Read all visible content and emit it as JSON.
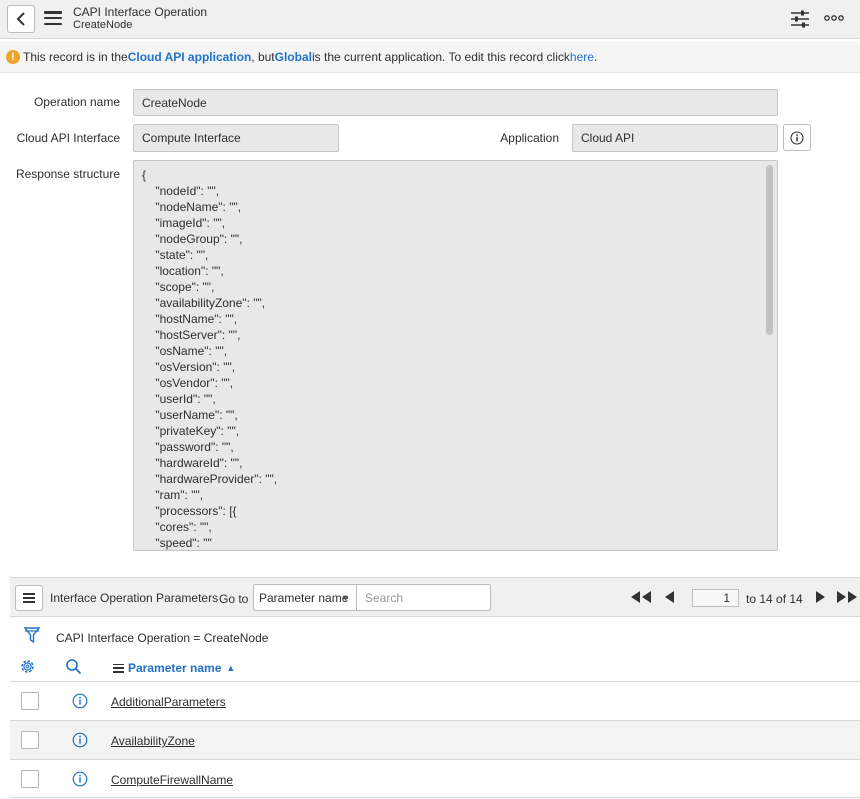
{
  "header": {
    "title": "CAPI Interface Operation",
    "subtitle": "CreateNode"
  },
  "notice": {
    "part1": "This record is in the ",
    "app_link": "Cloud API application",
    "part2": ", but ",
    "current_app": "Global",
    "part3": " is the current application. To edit this record click ",
    "here_link": "here",
    "part4": "."
  },
  "form": {
    "operation_name_label": "Operation name",
    "operation_name_value": "CreateNode",
    "cloud_api_interface_label": "Cloud API Interface",
    "cloud_api_interface_value": "Compute Interface",
    "application_label": "Application",
    "application_value": "Cloud API",
    "response_structure_label": "Response structure",
    "response_structure_value": "{\n    \"nodeId\": \"\",\n    \"nodeName\": \"\",\n    \"imageId\": \"\",\n    \"nodeGroup\": \"\",\n    \"state\": \"\",\n    \"location\": \"\",\n    \"scope\": \"\",\n    \"availabilityZone\": \"\",\n    \"hostName\": \"\",\n    \"hostServer\": \"\",\n    \"osName\": \"\",\n    \"osVersion\": \"\",\n    \"osVendor\": \"\",\n    \"userId\": \"\",\n    \"userName\": \"\",\n    \"privateKey\": \"\",\n    \"password\": \"\",\n    \"hardwareId\": \"\",\n    \"hardwareProvider\": \"\",\n    \"ram\": \"\",\n    \"processors\": [{\n    \"cores\": \"\",\n    \"speed\": \"\""
  },
  "list": {
    "title": "Interface Operation Parameters",
    "goto_label": "Go to",
    "goto_selected": "Parameter name",
    "search_placeholder": "Search",
    "page_value": "1",
    "page_of": "to 14 of 14",
    "filter_text": "CAPI Interface Operation = CreateNode",
    "column_header": "Parameter name",
    "rows": [
      {
        "name": "AdditionalParameters"
      },
      {
        "name": "AvailabilityZone"
      },
      {
        "name": "ComputeFirewallName"
      }
    ]
  },
  "colors": {
    "link": "#1f72c8",
    "warning": "#f0a32a",
    "header_bg": "#f0f0f0",
    "field_bg": "#e8e8e8"
  },
  "icons": {
    "back": "chevron-left-icon",
    "menu": "hamburger-icon",
    "settings": "sliders-icon",
    "more": "ellipsis-icon",
    "warning": "exclamation-icon",
    "info": "info-icon",
    "filter": "funnel-icon",
    "personalize": "gear-icon",
    "search": "search-icon"
  }
}
